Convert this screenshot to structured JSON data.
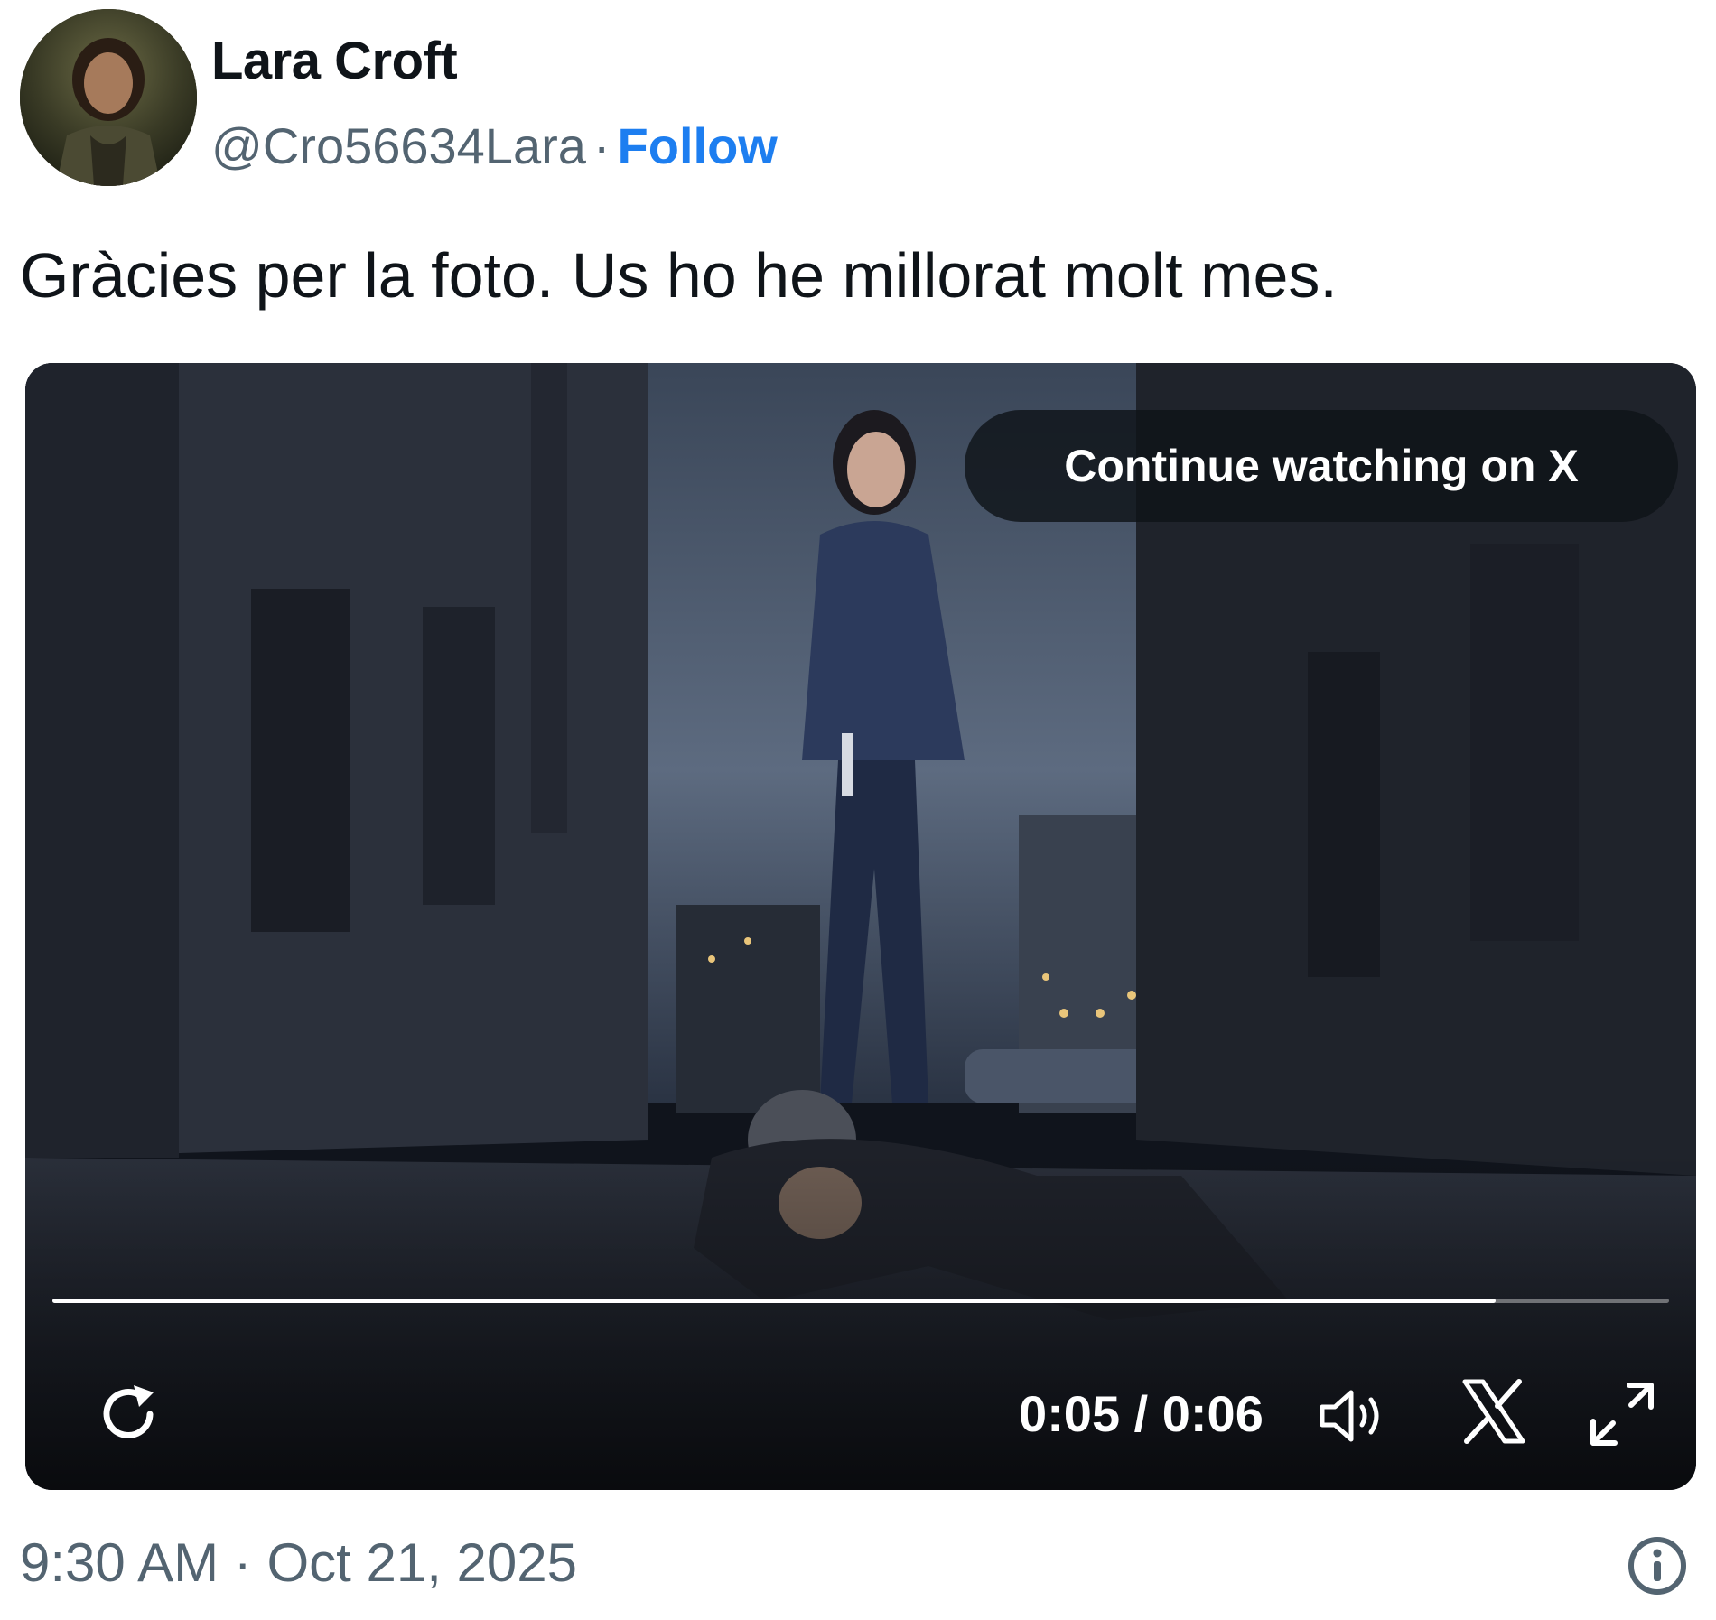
{
  "user": {
    "display_name": "Lara Croft",
    "handle": "@Cro56634Lara",
    "separator": "·",
    "follow_label": "Follow",
    "avatar_icon": "profile-photo"
  },
  "tweet": {
    "text": "Gràcies per la foto. Us ho he millorat molt mes."
  },
  "video": {
    "continue_label": "Continue watching on X",
    "time_display": "0:05 / 0:06",
    "progress": 0.893,
    "icons": {
      "replay": "replay-icon",
      "volume": "volume-icon",
      "x_logo": "x-logo-icon",
      "fullscreen": "fullscreen-icon"
    }
  },
  "footer": {
    "timestamp": "9:30 AM · Oct 21, 2025",
    "info_icon": "info-icon"
  },
  "colors": {
    "accent": "#1d7ef0",
    "secondary_text": "#536471",
    "primary_text": "#0f1419"
  }
}
